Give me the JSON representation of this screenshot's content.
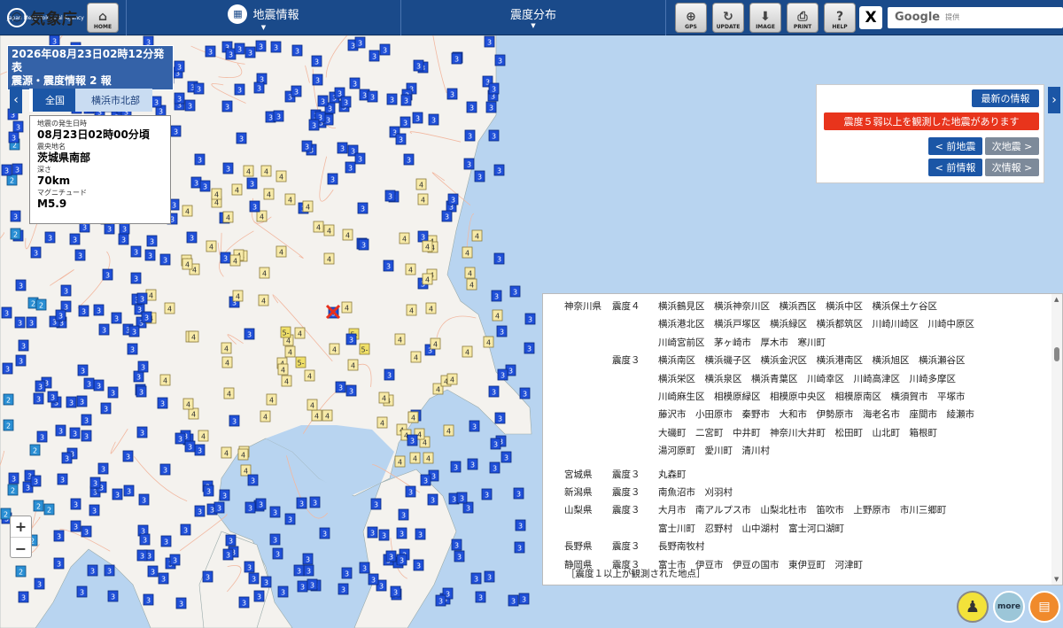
{
  "header": {
    "logo_ja": "気象庁",
    "logo_en": "Japan Meteorological Agency",
    "home_label": "HOME",
    "menu1_label": "地震情報",
    "menu2_label": "震度分布",
    "tools": [
      {
        "label": "GPS",
        "icon": "crosshair-icon"
      },
      {
        "label": "UPDATE",
        "icon": "refresh-icon"
      },
      {
        "label": "IMAGE",
        "icon": "download-icon"
      },
      {
        "label": "PRINT",
        "icon": "printer-icon"
      },
      {
        "label": "HELP",
        "icon": "question-icon"
      }
    ],
    "x_label": "X",
    "search_brand": "Google",
    "search_placeholder": "提供"
  },
  "issue": {
    "line1": "2026年08月23日02時12分発表",
    "line2": "震源・震度情報  2 報"
  },
  "breadcrumb": {
    "level1": "全国",
    "level2": "横浜市北部"
  },
  "quake": {
    "time_label": "地震の発生日時",
    "time": "08月23日02時00分頃",
    "place_label": "震央地名",
    "place": "茨城県南部",
    "depth_label": "深さ",
    "depth": "70km",
    "mag_label": "マグニチュード",
    "mag": "M5.9"
  },
  "notice": {
    "latest": "最新の情報",
    "alert": "震度５弱以上を観測した地震があります",
    "prev_quake": "< 前地震",
    "next_quake": "次地震 >",
    "prev_info": "< 前情報",
    "next_info": "次情報 >"
  },
  "list": {
    "rows": [
      {
        "pref": "神奈川県",
        "int": "震度４",
        "line": "横浜鶴見区　横浜神奈川区　横浜西区　横浜中区　横浜保土ケ谷区"
      },
      {
        "pref": "",
        "int": "",
        "line": "横浜港北区　横浜戸塚区　横浜緑区　横浜都筑区　川崎川崎区　川崎中原区"
      },
      {
        "pref": "",
        "int": "",
        "line": "川崎宮前区　茅ヶ崎市　厚木市　寒川町"
      },
      {
        "pref": "",
        "int": "震度３",
        "line": "横浜南区　横浜磯子区　横浜金沢区　横浜港南区　横浜旭区　横浜瀬谷区"
      },
      {
        "pref": "",
        "int": "",
        "line": "横浜栄区　横浜泉区　横浜青葉区　川崎幸区　川崎高津区　川崎多摩区"
      },
      {
        "pref": "",
        "int": "",
        "line": "川崎麻生区　相模原緑区　相模原中央区　相模原南区　横須賀市　平塚市"
      },
      {
        "pref": "",
        "int": "",
        "line": "藤沢市　小田原市　秦野市　大和市　伊勢原市　海老名市　座間市　綾瀬市"
      },
      {
        "pref": "",
        "int": "",
        "line": "大磯町　二宮町　中井町　神奈川大井町　松田町　山北町　箱根町"
      },
      {
        "pref": "",
        "int": "",
        "line": "湯河原町　愛川町　清川村"
      },
      {
        "pref": "宮城県",
        "int": "震度３",
        "line": "丸森町"
      },
      {
        "pref": "新潟県",
        "int": "震度３",
        "line": "南魚沼市　刈羽村"
      },
      {
        "pref": "山梨県",
        "int": "震度３",
        "line": "大月市　南アルプス市　山梨北杜市　笛吹市　上野原市　市川三郷町"
      },
      {
        "pref": "",
        "int": "",
        "line": "富士川町　忍野村　山中湖村　富士河口湖町"
      },
      {
        "pref": "長野県",
        "int": "震度３",
        "line": "長野南牧村"
      },
      {
        "pref": "静岡県",
        "int": "震度３",
        "line": "富士市　伊豆市　伊豆の国市　東伊豆町　河津町"
      }
    ],
    "footer": "［震度１以上が観測された地点］"
  },
  "zoom": {
    "plus": "+",
    "minus": "−"
  },
  "bottom": {
    "more_label": "more"
  },
  "colors": {
    "int5": "#f0e068",
    "int4": "#f7eaa8",
    "int3": "#1f4fd8",
    "int2": "#2a8fd4",
    "land": "#f4f2ee",
    "sea": "#b8d4f0",
    "header": "#1a4a8a",
    "alert": "#e8341c"
  }
}
